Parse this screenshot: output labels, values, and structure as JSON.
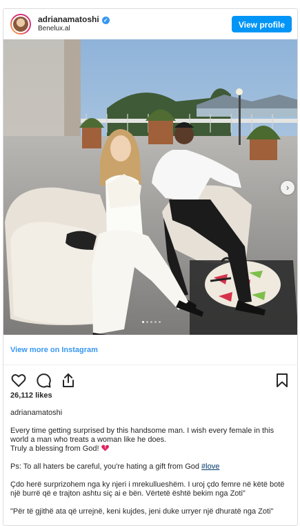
{
  "header": {
    "username": "adrianamatoshi",
    "location": "Benelux.al",
    "view_profile_label": "View profile"
  },
  "photo": {
    "carousel_dots": 5,
    "active_dot": 0
  },
  "view_more_label": "View more on Instagram",
  "likes": "26,112 likes",
  "owner": "adrianamatoshi",
  "caption": {
    "line1": "Every time getting surprised by this handsome man. I wish every female in this",
    "line2": "world a man who treats a woman like he does.",
    "line3": "Truly a blessing from God!",
    "line4_prefix": "Ps: To all haters be careful, you're hating a gift from God ",
    "hashtag": "#love",
    "line5": "Çdo herë surprizohem nga ky njeri i mrekullueshëm. I uroj çdo femre në këtë botë",
    "line6": "një burrë që e trajton ashtu siç ai e bën. Vërtetë është bekim nga Zoti\"",
    "line7": "\"Për të gjithë ata që urrejnë, keni kujdes, jeni duke urryer një dhuratë nga Zoti\""
  },
  "icons": {
    "verified": "verified-badge-icon",
    "like": "heart-icon",
    "comment": "comment-icon",
    "share": "share-icon",
    "save": "bookmark-icon",
    "next": "chevron-right-icon",
    "caption_emoji": "broken-heart-icon"
  },
  "colors": {
    "accent": "#0095f6",
    "link": "#3897f0",
    "hashtag": "#00376b",
    "emoji": "#e0245e"
  }
}
